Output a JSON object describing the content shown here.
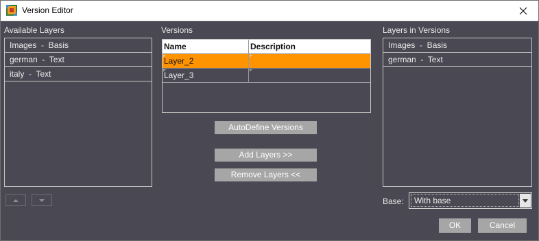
{
  "window": {
    "title": "Version Editor"
  },
  "available_layers": {
    "heading": "Available Layers",
    "items": [
      "Images  -  Basis",
      "german  -  Text",
      "italy  -  Text"
    ]
  },
  "versions": {
    "heading": "Versions",
    "columns": [
      "Name",
      "Description"
    ],
    "rows": [
      {
        "name": "Layer_2",
        "description": "",
        "selected": true
      },
      {
        "name": "Layer_3",
        "description": "",
        "selected": false
      }
    ],
    "selected_color": "#ff9400"
  },
  "buttons": {
    "autodefine": "AutoDefine Versions",
    "add_layers": "Add Layers >>",
    "remove_layers": "Remove Layers <<",
    "ok": "OK",
    "cancel": "Cancel"
  },
  "layers_in_versions": {
    "heading": "Layers in Versions",
    "items": [
      "Images  -  Basis",
      "german  -  Text"
    ]
  },
  "base": {
    "label": "Base:",
    "value": "With base"
  },
  "colors": {
    "background": "#4a4953",
    "button": "#a6a6a6",
    "accent": "#ff9400"
  }
}
